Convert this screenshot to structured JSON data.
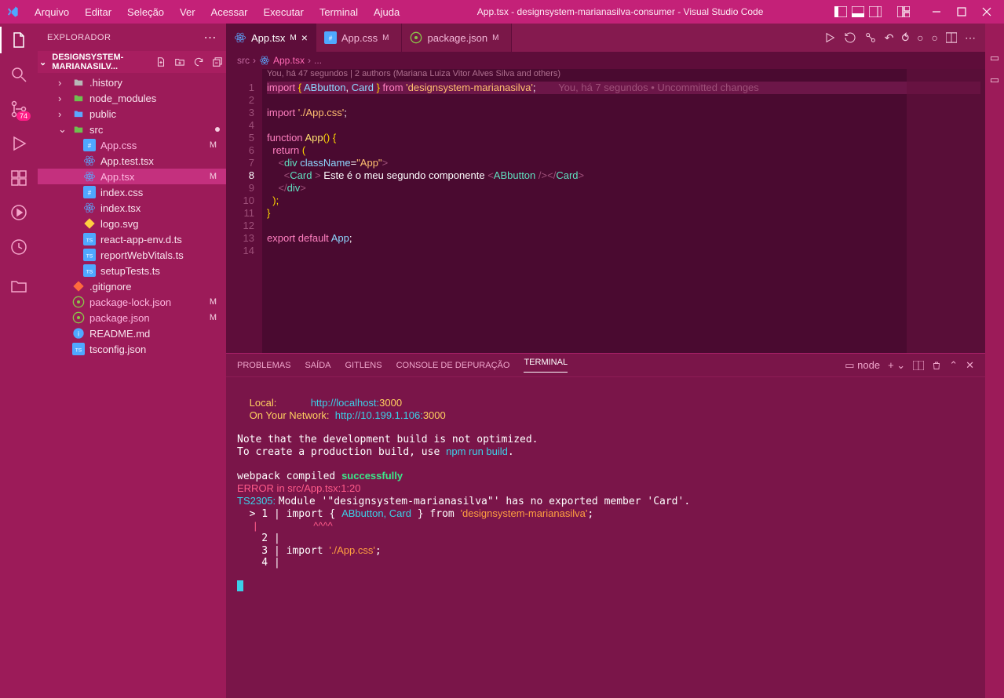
{
  "title": "App.tsx - designsystem-marianasilva-consumer - Visual Studio Code",
  "menu": [
    "Arquivo",
    "Editar",
    "Seleção",
    "Ver",
    "Acessar",
    "Executar",
    "Terminal",
    "Ajuda"
  ],
  "activity": {
    "badge": "74"
  },
  "sidebar": {
    "header": "EXPLORADOR",
    "section": "DESIGNSYSTEM-MARIANASILV...",
    "items": [
      {
        "depth": 0,
        "chev": "›",
        "icon": "folder",
        "label": ".history",
        "color": "#b8b8b8"
      },
      {
        "depth": 0,
        "chev": "›",
        "icon": "folder-green",
        "label": "node_modules",
        "color": "#6fbf4f"
      },
      {
        "depth": 0,
        "chev": "›",
        "icon": "folder-blue",
        "label": "public",
        "color": "#5ba8ff"
      },
      {
        "depth": 0,
        "chev": "⌄",
        "icon": "folder-green",
        "label": "src",
        "color": "#6fbf4f",
        "dot": true
      },
      {
        "depth": 1,
        "icon": "css",
        "label": "App.css",
        "status": "M",
        "mod": true
      },
      {
        "depth": 1,
        "icon": "react",
        "label": "App.test.tsx"
      },
      {
        "depth": 1,
        "icon": "react",
        "label": "App.tsx",
        "status": "M",
        "selected": true,
        "mod": true
      },
      {
        "depth": 1,
        "icon": "css",
        "label": "index.css"
      },
      {
        "depth": 1,
        "icon": "react",
        "label": "index.tsx"
      },
      {
        "depth": 1,
        "icon": "svg",
        "label": "logo.svg",
        "iconColor": "#ffd040"
      },
      {
        "depth": 1,
        "icon": "ts",
        "label": "react-app-env.d.ts"
      },
      {
        "depth": 1,
        "icon": "ts",
        "label": "reportWebVitals.ts"
      },
      {
        "depth": 1,
        "icon": "ts",
        "label": "setupTests.ts"
      },
      {
        "depth": 0,
        "icon": "git",
        "label": ".gitignore",
        "iconColor": "#ff6b3d"
      },
      {
        "depth": 0,
        "icon": "npm",
        "label": "package-lock.json",
        "status": "M",
        "mod": true,
        "iconColor": "#8bc34a"
      },
      {
        "depth": 0,
        "icon": "npm",
        "label": "package.json",
        "status": "M",
        "mod": true,
        "iconColor": "#8bc34a"
      },
      {
        "depth": 0,
        "icon": "info",
        "label": "README.md",
        "iconColor": "#4fa8ff"
      },
      {
        "depth": 0,
        "icon": "tsconfig",
        "label": "tsconfig.json",
        "iconColor": "#4fa8ff"
      }
    ]
  },
  "tabs": [
    {
      "icon": "react",
      "label": "App.tsx",
      "badge": "M",
      "active": true,
      "close": "×"
    },
    {
      "icon": "css",
      "label": "App.css",
      "badge": "M",
      "close": ""
    },
    {
      "icon": "npm",
      "label": "package.json",
      "badge": "M",
      "close": ""
    }
  ],
  "breadcrumb": [
    "src",
    "App.tsx",
    "..."
  ],
  "codelens": "You, há 47 segundos | 2 authors (Mariana Luiza Vitor Alves Silva and others)",
  "blame": "You, há 7 segundos • Uncommitted changes",
  "code": {
    "lines": 14,
    "l1": {
      "a": "import",
      "b": "{",
      "c": "ABbutton",
      "d": ",",
      "e": "Card",
      "f": "}",
      "g": "from",
      "h": "'designsystem-marianasilva'",
      "i": ";"
    },
    "l3": {
      "a": "import",
      "b": "'./App.css'",
      "c": ";"
    },
    "l5": {
      "a": "function",
      "b": "App",
      "c": "()",
      "d": "{"
    },
    "l6": {
      "a": "return",
      "b": "("
    },
    "l7": {
      "a": "<",
      "b": "div",
      "c": "className",
      "d": "=",
      "e": "\"App\"",
      "f": ">"
    },
    "l8": {
      "a": "<",
      "b": "Card",
      "c": ">",
      "d": "Este é o meu segundo componente",
      "e": "<",
      "f": "ABbutton",
      "g": "/><",
      "h": "/",
      "i": "Card",
      "j": ">"
    },
    "l9": {
      "a": "<",
      "b": "/",
      "c": "div",
      "d": ">"
    },
    "l10": {
      "a": ");"
    },
    "l11": {
      "a": "}"
    },
    "l13": {
      "a": "export",
      "b": "default",
      "c": "App",
      "d": ";"
    }
  },
  "panel": {
    "tabs": [
      "PROBLEMAS",
      "SAÍDA",
      "GITLENS",
      "CONSOLE DE DEPURAÇÃO",
      "TERMINAL"
    ],
    "active": 4,
    "rightLabel": "node",
    "terminal": {
      "local_label": "Local:",
      "local_url_pre": "http://localhost:",
      "local_port": "3000",
      "net_label": "On Your Network:",
      "net_url_pre": "http://10.199.1.106:",
      "net_port": "3000",
      "note1": "Note that the development build is not optimized.",
      "note2_pre": "To create a production build, use ",
      "note2_cmd": "npm run build",
      "note2_post": ".",
      "webpack_pre": "webpack compiled ",
      "webpack_ok": "successfully",
      "error": "ERROR in src/App.tsx:1:20",
      "ts_pre": "TS2305: ",
      "ts_msg": "Module '\"designsystem-marianasilva\"' has no exported member 'Card'.",
      "src1_pre": "  > 1 | ",
      "src1_a": "import { ",
      "src1_b": "ABbutton, Card",
      "src1_c": " } from ",
      "src1_d": "'designsystem-marianasilva'",
      "src1_e": ";",
      "caret": "      |                    ^^^^",
      "src2": "    2 |",
      "src3_pre": "    3 | import ",
      "src3_a": "'./App.css'",
      "src3_b": ";",
      "src4": "    4 |"
    }
  }
}
